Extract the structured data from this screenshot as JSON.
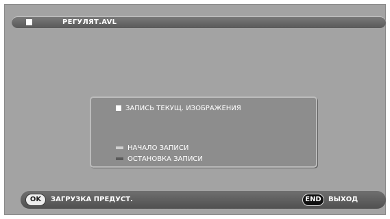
{
  "header": {
    "title": "РЕГУЛЯТ.AVL"
  },
  "dialog": {
    "heading": "ЗАПИСЬ ТЕКУЩ. ИЗОБРАЖЕНИЯ",
    "option_start": "НАЧАЛО ЗАПИСИ",
    "option_stop": "ОСТАНОВКА ЗАПИСИ"
  },
  "footer": {
    "ok_key": "OK",
    "ok_label": "ЗАГРУЗКА ПРЕДУСТ.",
    "end_key": "END",
    "end_label": "ВЫХОД"
  },
  "colors": {
    "screen_background": "#a3a3a3",
    "bar": "#606060",
    "dialog": "#8d8d8d"
  }
}
